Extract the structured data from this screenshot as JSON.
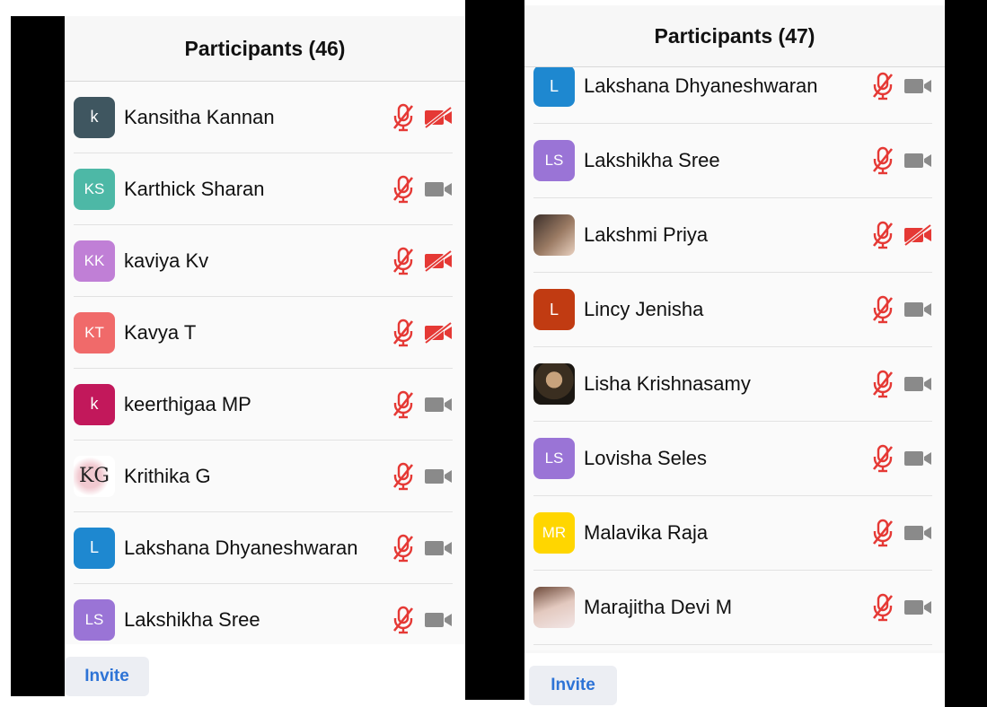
{
  "left": {
    "title": "Participants (46)",
    "invite_label": "Invite",
    "participants": [
      {
        "initials": "k",
        "name": "Kansitha Kannan",
        "color": "#3f5660",
        "video_off": true
      },
      {
        "initials": "KS",
        "name": "Karthick Sharan",
        "color": "#4db8a6",
        "video_off": false
      },
      {
        "initials": "KK",
        "name": "kaviya Kv",
        "color": "#c07fd6",
        "video_off": true
      },
      {
        "initials": "KT",
        "name": "Kavya T",
        "color": "#f06a6a",
        "video_off": true
      },
      {
        "initials": "k",
        "name": "keerthigaa MP",
        "color": "#c2185b",
        "video_off": false
      },
      {
        "initials": "KG",
        "name": "Krithika G",
        "color": "",
        "avatar": "kg",
        "video_off": false
      },
      {
        "initials": "L",
        "name": "Lakshana Dhyaneshwaran",
        "color": "#1e88d0",
        "video_off": false
      },
      {
        "initials": "LS",
        "name": "Lakshikha Sree",
        "color": "#9a74d6",
        "video_off": false
      }
    ]
  },
  "right": {
    "title": "Participants (47)",
    "invite_label": "Invite",
    "participants": [
      {
        "initials": "L",
        "name": "Lakshana Dhyaneshwaran",
        "color": "#1e88d0",
        "video_off": false
      },
      {
        "initials": "LS",
        "name": "Lakshikha Sree",
        "color": "#9a74d6",
        "video_off": false
      },
      {
        "initials": "",
        "name": "Lakshmi Priya",
        "color": "",
        "avatar": "photo",
        "video_off": true
      },
      {
        "initials": "L",
        "name": "Lincy Jenisha",
        "color": "#c13b12",
        "video_off": false
      },
      {
        "initials": "",
        "name": "Lisha Krishnasamy",
        "color": "",
        "avatar": "photo2",
        "video_off": false
      },
      {
        "initials": "LS",
        "name": "Lovisha Seles",
        "color": "#9a74d6",
        "video_off": false
      },
      {
        "initials": "MR",
        "name": "Malavika Raja",
        "color": "#ffd600",
        "video_off": false
      },
      {
        "initials": "",
        "name": "Marajitha Devi M",
        "color": "",
        "avatar": "photo3",
        "video_off": false
      }
    ]
  },
  "colors": {
    "muted_red": "#e53935",
    "video_gray": "#8a8a8a",
    "invite_blue": "#2d73d6"
  },
  "icons": {
    "mic": "mic-muted-icon",
    "video_on": "video-icon",
    "video_off": "video-off-icon"
  }
}
